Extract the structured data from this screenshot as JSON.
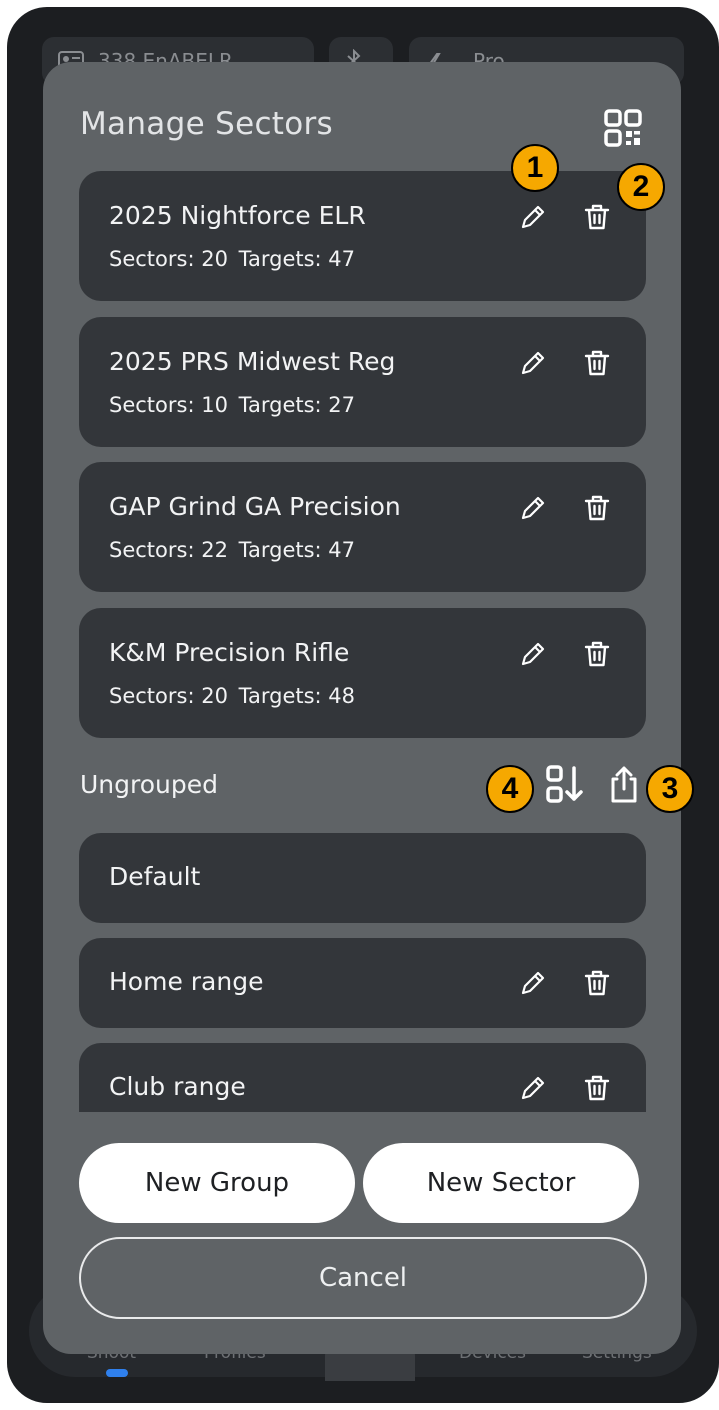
{
  "topbar": {
    "profile_label": "338 EnABELR",
    "device_label": "Pro"
  },
  "bottom_nav": {
    "shoot": "Shoot",
    "profiles": "Profiles",
    "devices": "Devices",
    "settings": "Settings"
  },
  "modal": {
    "title": "Manage Sectors"
  },
  "groups": [
    {
      "name": "2025 Nightforce ELR",
      "sectors_label": "Sectors: 20",
      "targets_label": "Targets: 47"
    },
    {
      "name": "2025 PRS Midwest Reg",
      "sectors_label": "Sectors: 10",
      "targets_label": "Targets: 27"
    },
    {
      "name": "GAP Grind GA Precision",
      "sectors_label": "Sectors: 22",
      "targets_label": "Targets: 47"
    },
    {
      "name": "K&M Precision Rifle",
      "sectors_label": "Sectors: 20",
      "targets_label": "Targets: 48"
    }
  ],
  "ungrouped": {
    "label": "Ungrouped",
    "items": [
      {
        "name": "Default"
      },
      {
        "name": "Home range"
      },
      {
        "name": "Club range"
      }
    ]
  },
  "buttons": {
    "new_group": "New Group",
    "new_sector": "New Sector",
    "cancel": "Cancel"
  },
  "badges": [
    "1",
    "2",
    "3",
    "4"
  ],
  "colors": {
    "accent": "#f6a800",
    "modal": "#5f6366",
    "card": "#33363a"
  }
}
